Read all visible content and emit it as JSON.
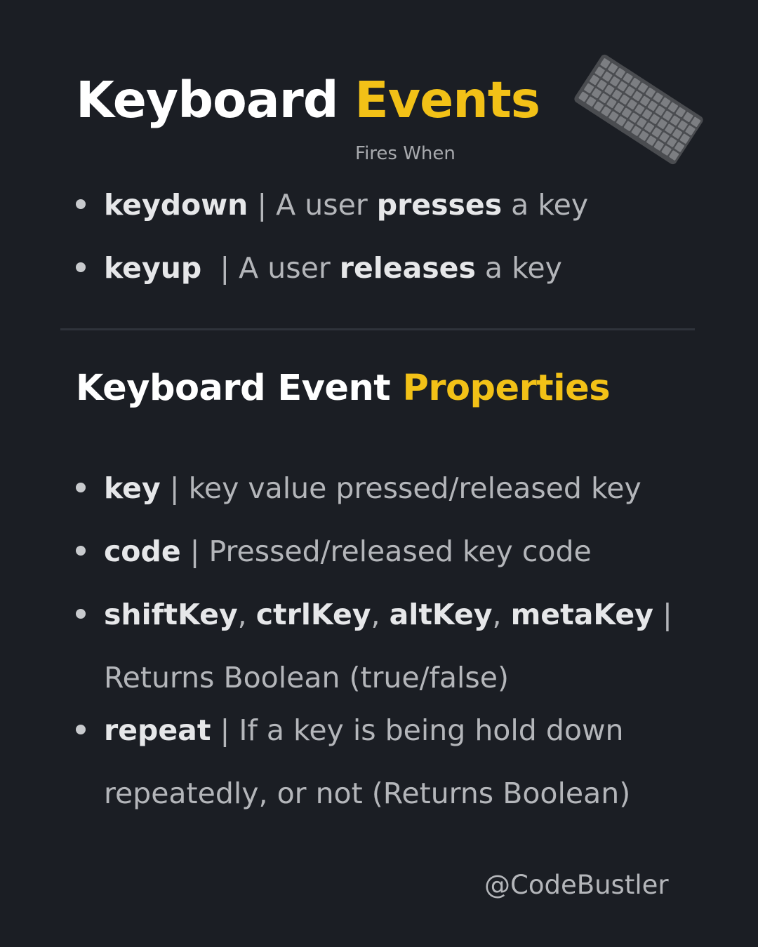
{
  "title": {
    "main": "Keyboard",
    "accent": "Events"
  },
  "fires_when": "Fires When",
  "events": [
    {
      "name": "keydown",
      "sep": " | ",
      "pre": "A user ",
      "strong": "presses",
      "post": " a key"
    },
    {
      "name": "keyup",
      "sep": "  | ",
      "pre": "A user ",
      "strong": "releases",
      "post": " a key"
    }
  ],
  "subtitle": {
    "main": "Keyboard Event",
    "accent": "Properties"
  },
  "properties": [
    {
      "name": "key",
      "desc": " | key value pressed/released key"
    },
    {
      "name": "code",
      "desc": " | Pressed/released key code"
    },
    {
      "names": [
        "shiftKey",
        "ctrlKey",
        "altKey",
        "metaKey"
      ],
      "comma": ", ",
      "sep": " |",
      "desc": "Returns Boolean (true/false)"
    },
    {
      "name": "repeat",
      "desc": " | If a key is being hold down",
      "desc2": "repeatedly, or not (Returns Boolean)"
    }
  ],
  "handle": "@CodeBustler",
  "colors": {
    "background": "#1b1e24",
    "accent": "#f2c117",
    "text": "#b4b6ba",
    "bold": "#e6e7e9"
  },
  "icons": [
    "keyboard-icon"
  ]
}
